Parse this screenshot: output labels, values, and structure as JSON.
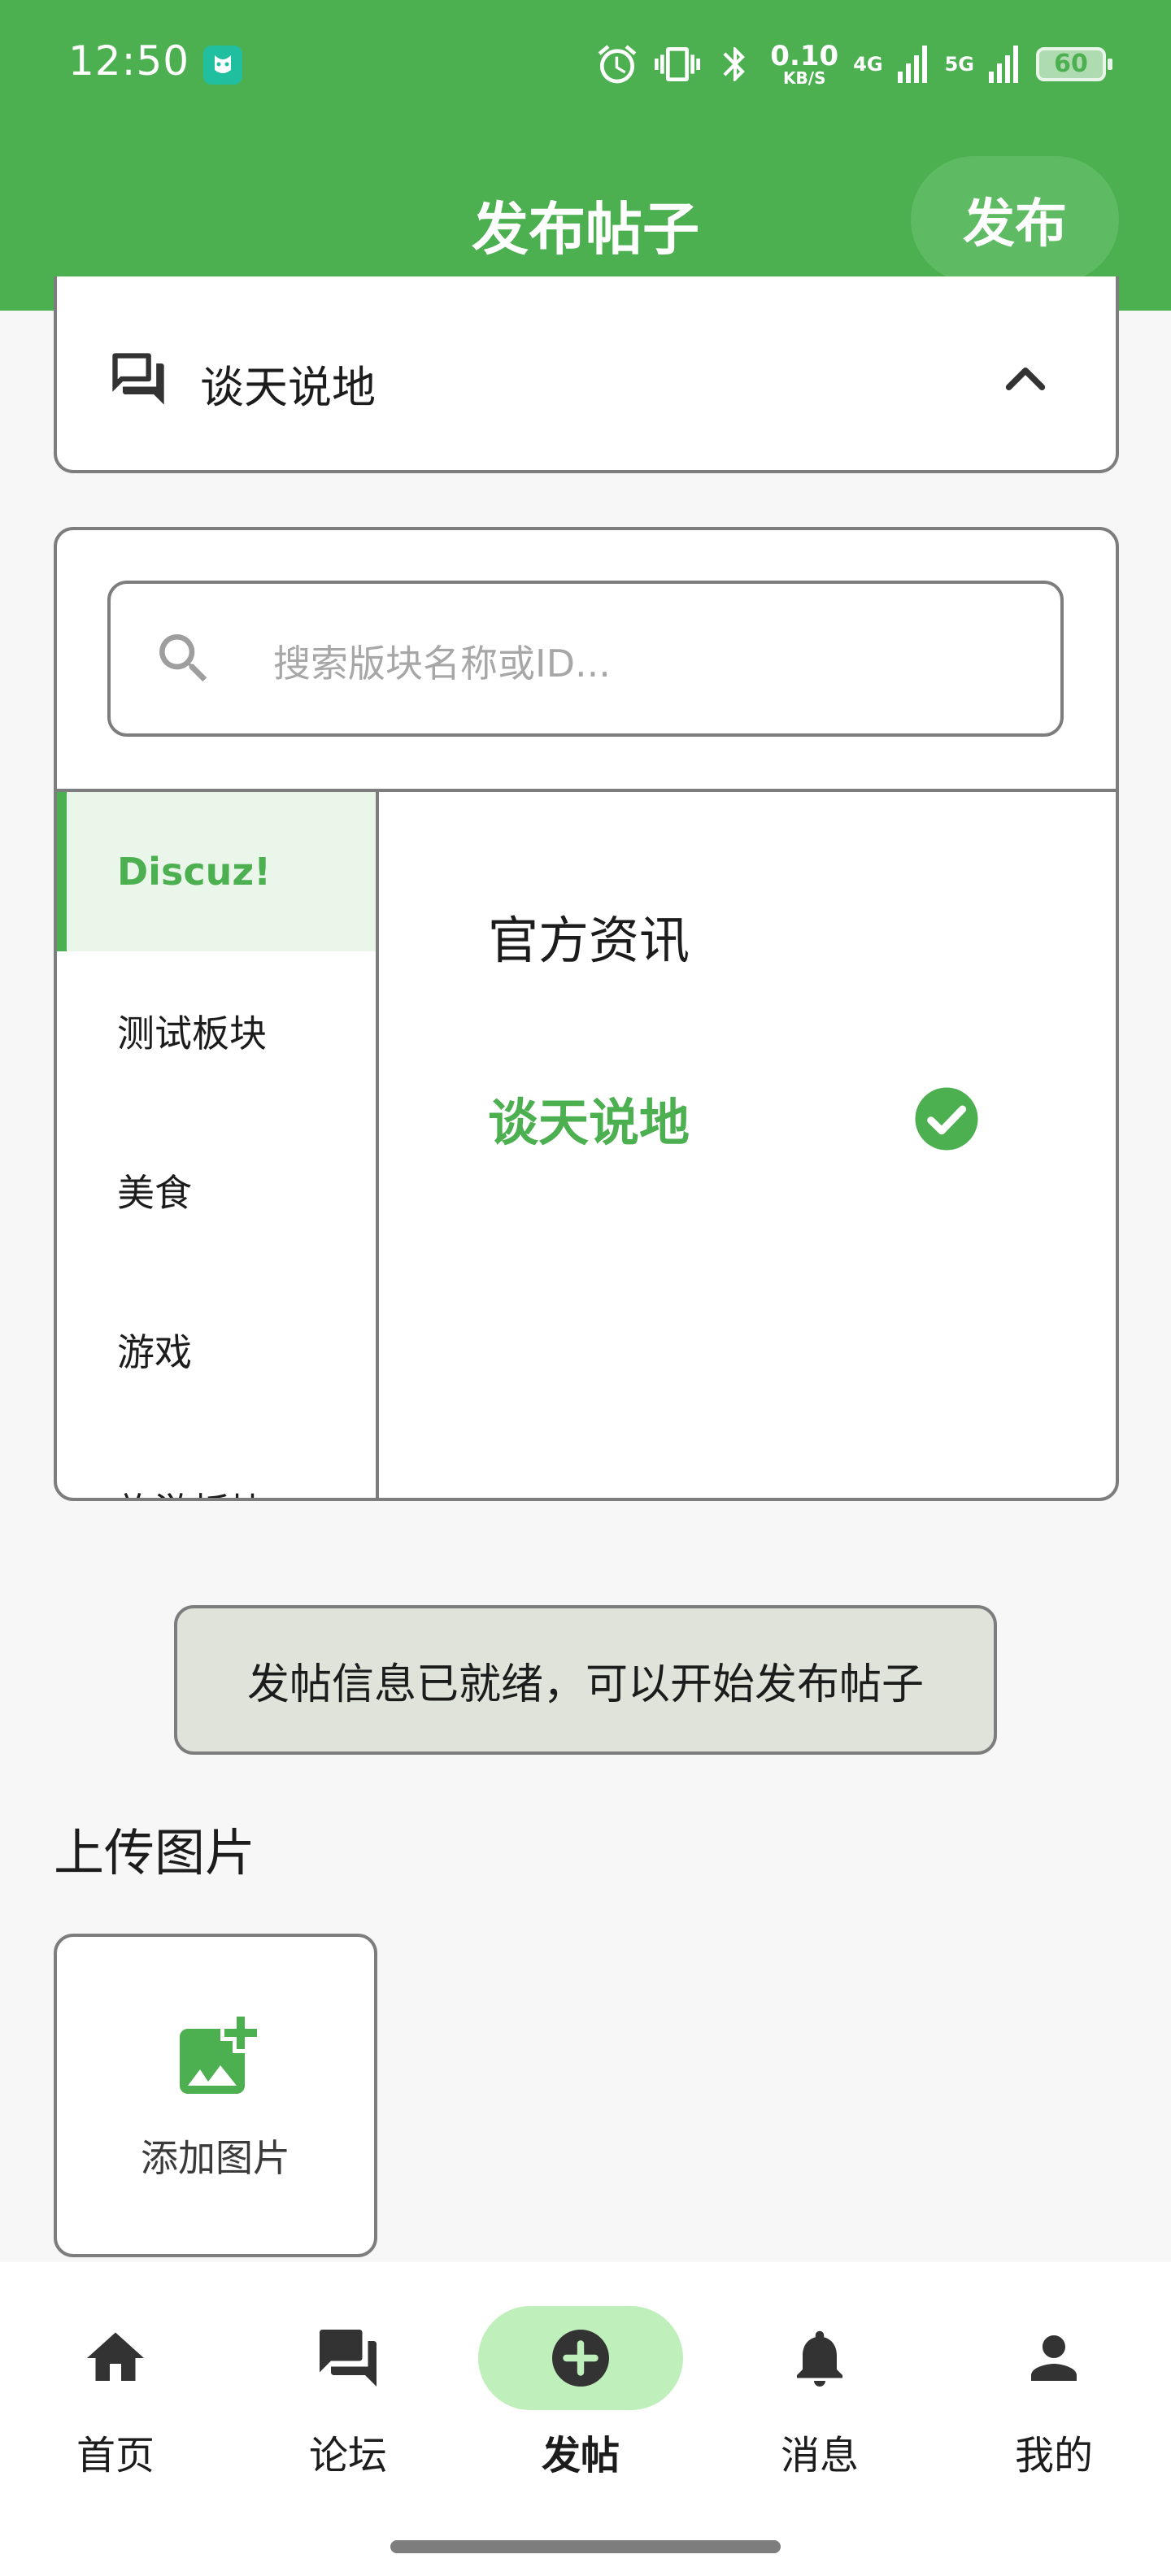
{
  "status_bar": {
    "time": "12:50",
    "speed_value": "0.10",
    "speed_unit": "KB/S",
    "net_4g": "4G",
    "net_5g": "5G",
    "battery": "60"
  },
  "app_bar": {
    "title": "发布帖子",
    "publish_label": "发布"
  },
  "forum_selector": {
    "selected_label": "谈天说地",
    "expanded": true
  },
  "forum_picker": {
    "search_placeholder": "搜索版块名称或ID...",
    "groups": [
      {
        "label": "Discuz!",
        "selected": true
      },
      {
        "label": "测试板块",
        "selected": false
      },
      {
        "label": "美食",
        "selected": false
      },
      {
        "label": "游戏",
        "selected": false
      },
      {
        "label": "旅游板块",
        "selected": false
      }
    ],
    "forums": [
      {
        "label": "官方资讯",
        "selected": false
      },
      {
        "label": "谈天说地",
        "selected": true
      }
    ]
  },
  "toast": "发帖信息已就绪，可以开始发布帖子",
  "upload": {
    "section_title": "上传图片",
    "add_label": "添加图片"
  },
  "bottom_nav": {
    "items": [
      {
        "label": "首页",
        "icon": "home-icon",
        "active": false
      },
      {
        "label": "论坛",
        "icon": "forum-icon",
        "active": false
      },
      {
        "label": "发帖",
        "icon": "add-circle-icon",
        "active": true
      },
      {
        "label": "消息",
        "icon": "bell-icon",
        "active": false
      },
      {
        "label": "我的",
        "icon": "person-icon",
        "active": false
      }
    ]
  },
  "colors": {
    "primary": "#4caf50",
    "nav_active_bg": "#bff0bb",
    "toast_bg": "#dfe3da"
  }
}
